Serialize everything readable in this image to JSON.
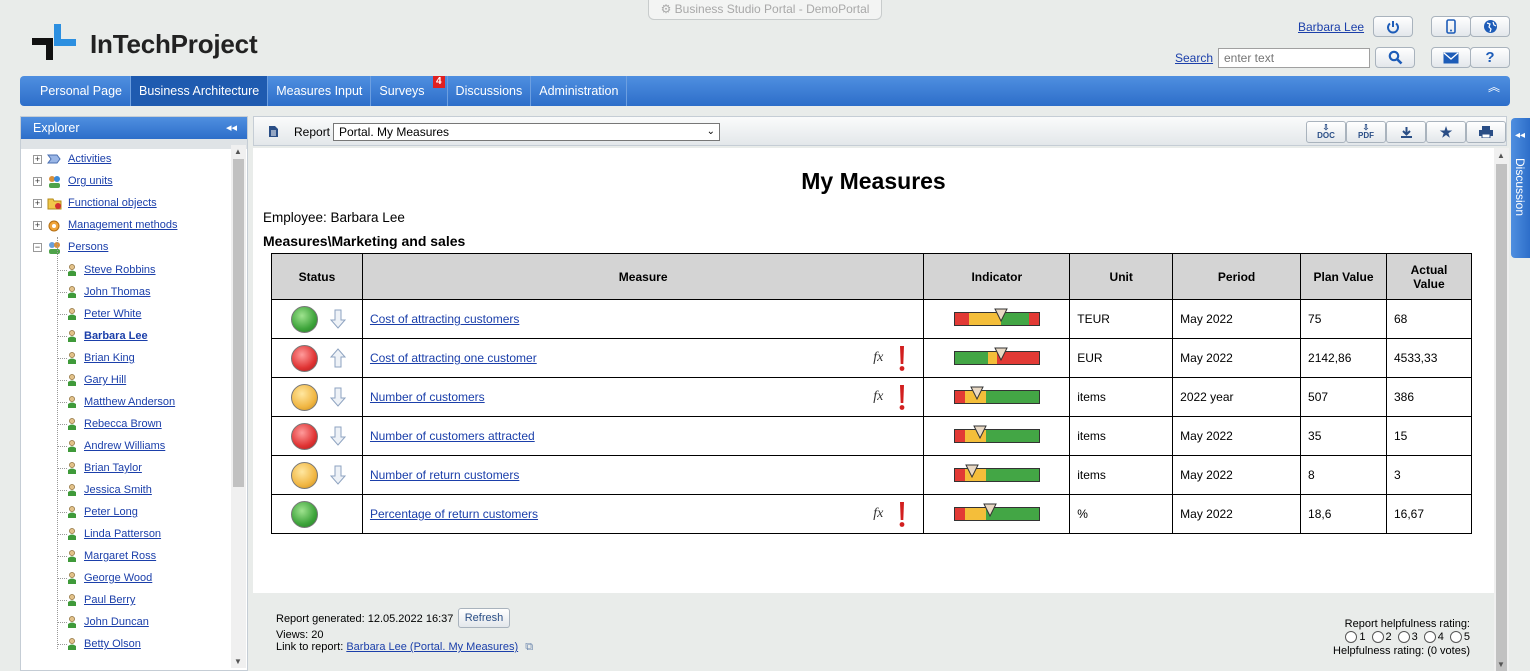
{
  "window_title": "Business Studio Portal - DemoPortal",
  "logo": {
    "name": "InTechProject"
  },
  "header": {
    "user": "Barbara Lee",
    "search_label": "Search",
    "search_placeholder": "enter text"
  },
  "menu": [
    {
      "label": "Personal Page",
      "active": false
    },
    {
      "label": "Business Architecture",
      "active": true
    },
    {
      "label": "Measures Input",
      "active": false
    },
    {
      "label": "Surveys",
      "active": false,
      "badge": "4"
    },
    {
      "label": "Discussions",
      "active": false
    },
    {
      "label": "Administration",
      "active": false
    }
  ],
  "explorer": {
    "title": "Explorer",
    "roots": [
      {
        "label": "Activities",
        "icon": "activities-icon",
        "expander": "+"
      },
      {
        "label": "Org units",
        "icon": "org-units-icon",
        "expander": "+"
      },
      {
        "label": "Functional objects",
        "icon": "functional-objects-icon",
        "expander": "+"
      },
      {
        "label": "Management methods",
        "icon": "management-methods-icon",
        "expander": "+"
      },
      {
        "label": "Persons",
        "icon": "persons-icon",
        "expander": "−"
      }
    ],
    "persons": [
      "Steve Robbins",
      "John Thomas",
      "Peter White",
      "Barbara Lee",
      "Brian King",
      "Gary Hill",
      "Matthew Anderson",
      "Rebecca Brown",
      "Andrew Williams",
      "Brian Taylor",
      "Jessica Smith",
      "Peter Long",
      "Linda Patterson",
      "Margaret Ross",
      "George Wood",
      "Paul Berry",
      "John Duncan",
      "Betty Olson"
    ],
    "selected_person": "Barbara Lee"
  },
  "report_bar": {
    "label": "Report",
    "selected": "Portal. My Measures",
    "buttons": [
      {
        "name": "export-doc-button",
        "text": "DOC"
      },
      {
        "name": "export-pdf-button",
        "text": "PDF"
      },
      {
        "name": "download-button",
        "text": ""
      },
      {
        "name": "favorite-button",
        "text": ""
      },
      {
        "name": "print-button",
        "text": ""
      }
    ]
  },
  "report": {
    "title": "My Measures",
    "employee": "Employee: Barbara Lee",
    "section": "Measures\\Marketing and sales",
    "columns": [
      "Status",
      "Measure",
      "Indicator",
      "Unit",
      "Period",
      "Plan Value",
      "Actual Value"
    ],
    "rows": [
      {
        "status": "green",
        "trend": "down",
        "measure": "Cost of attracting customers",
        "fx": false,
        "alert": false,
        "unit": "TEUR",
        "period": "May 2022",
        "plan": "75",
        "actual": "68",
        "indicator": {
          "layout": "red-yellow-green-red",
          "pointer": 0.55
        }
      },
      {
        "status": "red",
        "trend": "up",
        "measure": "Cost of attracting one customer",
        "fx": true,
        "alert": true,
        "unit": "EUR",
        "period": "May 2022",
        "plan": "2142,86",
        "actual": "4533,33",
        "indicator": {
          "layout": "green-yellow-red",
          "pointer": 0.55
        }
      },
      {
        "status": "yellow",
        "trend": "down",
        "measure": "Number of customers",
        "fx": true,
        "alert": true,
        "unit": "items",
        "period": "2022 year",
        "plan": "507",
        "actual": "386",
        "indicator": {
          "layout": "red-yellow-green",
          "pointer": 0.27
        }
      },
      {
        "status": "red",
        "trend": "down",
        "measure": "Number of customers attracted",
        "fx": false,
        "alert": false,
        "unit": "items",
        "period": "May 2022",
        "plan": "35",
        "actual": "15",
        "indicator": {
          "layout": "red-yellow-green",
          "pointer": 0.3
        }
      },
      {
        "status": "yellow",
        "trend": "down",
        "measure": "Number of return customers",
        "fx": false,
        "alert": false,
        "unit": "items",
        "period": "May 2022",
        "plan": "8",
        "actual": "3",
        "indicator": {
          "layout": "red-yellow-green",
          "pointer": 0.2
        }
      },
      {
        "status": "green",
        "trend": "none",
        "measure": "Percentage of return customers",
        "fx": true,
        "alert": true,
        "unit": "%",
        "period": "May 2022",
        "plan": "18,6",
        "actual": "16,67",
        "indicator": {
          "layout": "red-yellow-green",
          "pointer": 0.42
        }
      }
    ]
  },
  "footer": {
    "generated": "Report generated: 12.05.2022 16:37",
    "refresh": "Refresh",
    "views": "Views: 20",
    "link_label": "Link to report:",
    "link_text": "Barbara Lee (Portal. My Measures)",
    "rating_label": "Report helpfulness rating:",
    "rating_options": [
      "1",
      "2",
      "3",
      "4",
      "5"
    ],
    "rating_text": "Helpfulness rating: (0 votes)"
  },
  "discussion_tab": "Discussion",
  "colors": {
    "menu_blue": "#2d6ec9",
    "menu_active": "#1f5bb0",
    "link": "#1b3faa",
    "green": "#3ea43b",
    "red": "#e03434",
    "yellow": "#f1b744",
    "badge": "#e02020"
  }
}
